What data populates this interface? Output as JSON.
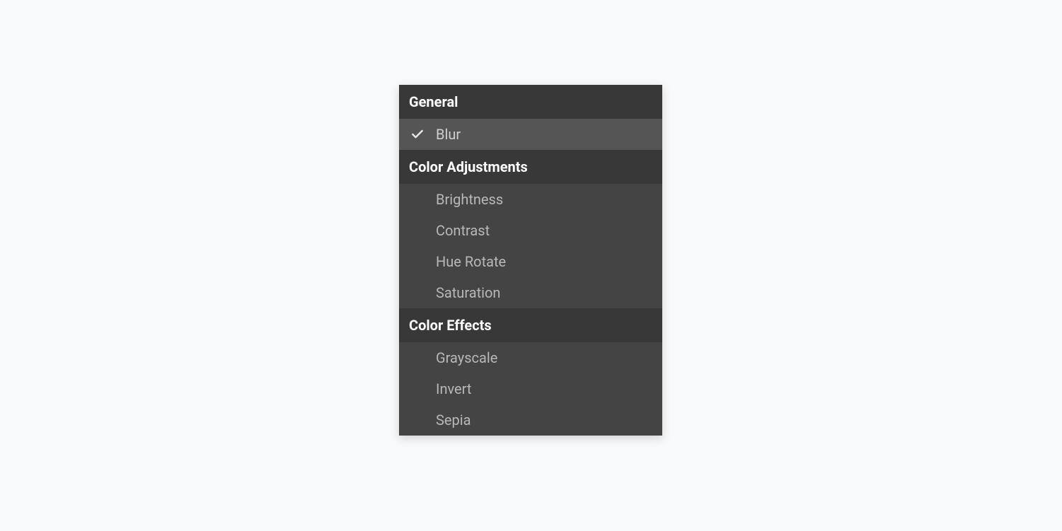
{
  "menu": {
    "groups": [
      {
        "header": "General",
        "items": [
          {
            "label": "Blur",
            "selected": true
          }
        ]
      },
      {
        "header": "Color Adjustments",
        "items": [
          {
            "label": "Brightness",
            "selected": false
          },
          {
            "label": "Contrast",
            "selected": false
          },
          {
            "label": "Hue Rotate",
            "selected": false
          },
          {
            "label": "Saturation",
            "selected": false
          }
        ]
      },
      {
        "header": "Color Effects",
        "items": [
          {
            "label": "Grayscale",
            "selected": false
          },
          {
            "label": "Invert",
            "selected": false
          },
          {
            "label": "Sepia",
            "selected": false
          }
        ]
      }
    ]
  }
}
